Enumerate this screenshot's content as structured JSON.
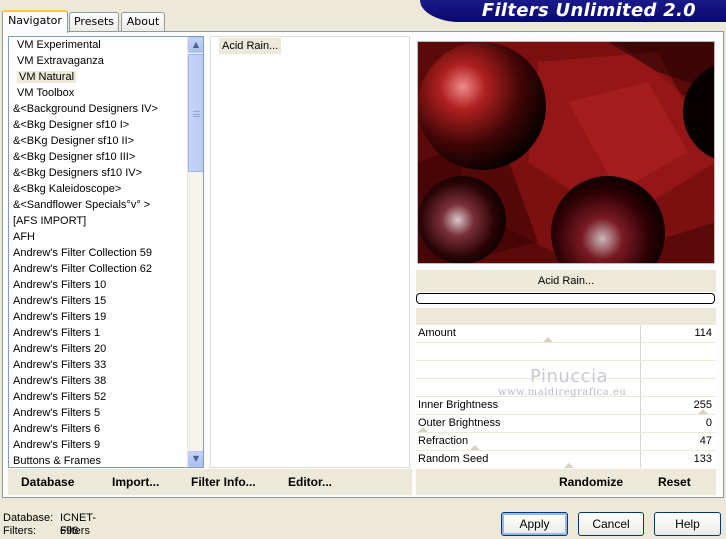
{
  "app": {
    "title": "Filters Unlimited 2.0"
  },
  "tabs": [
    {
      "label": "Navigator"
    },
    {
      "label": "Presets"
    },
    {
      "label": "About"
    }
  ],
  "categories": [
    {
      "label": "VM Experimental",
      "indent": true
    },
    {
      "label": "VM Extravaganza",
      "indent": true
    },
    {
      "label": "VM Natural",
      "indent": true,
      "selected": true
    },
    {
      "label": "VM Toolbox",
      "indent": true
    },
    {
      "label": "&<Background Designers IV>"
    },
    {
      "label": "&<Bkg Designer sf10 I>"
    },
    {
      "label": "&<BKg Designer sf10 II>"
    },
    {
      "label": "&<Bkg Designer sf10 III>"
    },
    {
      "label": "&<Bkg Designers sf10 IV>"
    },
    {
      "label": "&<Bkg Kaleidoscope>"
    },
    {
      "label": "&<Sandflower Specials°v° >"
    },
    {
      "label": "[AFS IMPORT]"
    },
    {
      "label": "AFH"
    },
    {
      "label": "Andrew's Filter Collection 59"
    },
    {
      "label": "Andrew's Filter Collection 62"
    },
    {
      "label": "Andrew's Filters 10"
    },
    {
      "label": "Andrew's Filters 15"
    },
    {
      "label": "Andrew's Filters 19"
    },
    {
      "label": "Andrew's Filters 1"
    },
    {
      "label": "Andrew's Filters 20"
    },
    {
      "label": "Andrew's Filters 33"
    },
    {
      "label": "Andrew's Filters 38"
    },
    {
      "label": "Andrew's Filters 52"
    },
    {
      "label": "Andrew's Filters 5"
    },
    {
      "label": "Andrew's Filters 6"
    },
    {
      "label": "Andrew's Filters 9"
    },
    {
      "label": "Buttons & Frames"
    }
  ],
  "filters": [
    {
      "label": "Acid Rain..."
    }
  ],
  "selected_filter": "Acid Rain...",
  "params": [
    {
      "label": "Amount",
      "value": "114",
      "level": 114
    },
    {
      "label": "",
      "value": ""
    },
    {
      "label": "",
      "value": ""
    },
    {
      "label": "",
      "value": ""
    },
    {
      "label": "Inner Brightness",
      "value": "255",
      "level": 255
    },
    {
      "label": "Outer Brightness",
      "value": "0",
      "level": 0
    },
    {
      "label": "Refraction",
      "value": "47",
      "level": 47
    },
    {
      "label": "Random Seed",
      "value": "133",
      "level": 133
    }
  ],
  "watermark": {
    "line1": "Pinuccia",
    "line2": "www.maidiregrafica.eu"
  },
  "left_buttons": {
    "database": "Database",
    "import": "Import...",
    "filter_info": "Filter Info...",
    "editor": "Editor..."
  },
  "right_buttons": {
    "randomize": "Randomize",
    "reset": "Reset"
  },
  "footer": {
    "database_label": "Database:",
    "database_value": "ICNET-Filters",
    "filters_label": "Filters:",
    "filters_value": "696"
  },
  "dialog_buttons": {
    "apply": "Apply",
    "cancel": "Cancel",
    "help": "Help"
  },
  "colors": {
    "banner": "#0a0a6a",
    "preview_bg": "#6a0b0b",
    "tab_highlight": "#ffc83c"
  }
}
